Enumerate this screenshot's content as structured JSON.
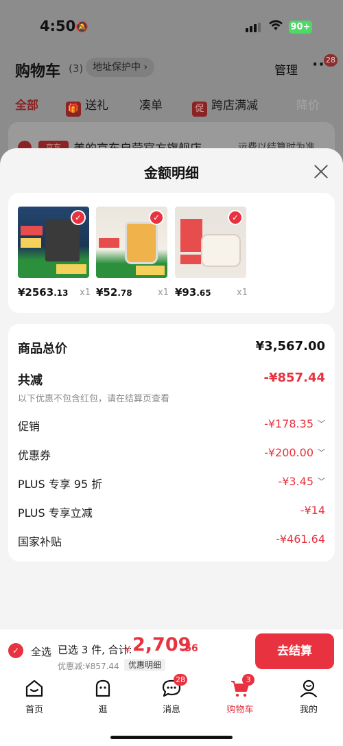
{
  "status_bar": {
    "time": "4:50",
    "battery": "90+"
  },
  "cart_header": {
    "title": "购物车",
    "count": "(3)",
    "address": "地址保护中 ›",
    "manage": "管理",
    "more_badge": "28"
  },
  "cart_tabs": [
    {
      "label": "全部"
    },
    {
      "label": "送礼"
    },
    {
      "label": "凑单"
    },
    {
      "label": "跨店满减",
      "icon": "促"
    },
    {
      "label": "降价"
    }
  ],
  "shop_row": {
    "tag": "京东",
    "name": "美的京东自营官方旗舰店",
    "shipping": "运费以结算时为准"
  },
  "sheet": {
    "title": "金额明细",
    "products": [
      {
        "price_int": "¥2563",
        "price_dec": ".13",
        "qty": "x1",
        "image": "water-heater"
      },
      {
        "price_int": "¥52",
        "price_dec": ".78",
        "qty": "x1",
        "image": "food-processor"
      },
      {
        "price_int": "¥93",
        "price_dec": ".65",
        "qty": "x1",
        "image": "stew-pot"
      }
    ],
    "breakdown": {
      "total_label": "商品总价",
      "total_value": "¥3,567.00",
      "reduce_label": "共减",
      "reduce_value": "-¥857.44",
      "reduce_note": "以下优惠不包含红包，请在结算页查看",
      "items": [
        {
          "label": "促销",
          "value": "-¥178.35",
          "expandable": true
        },
        {
          "label": "优惠券",
          "value": "-¥200.00",
          "expandable": true
        },
        {
          "label": "PLUS 专享 95 折",
          "value": "-¥3.45",
          "expandable": true
        },
        {
          "label": "PLUS 专享立减",
          "value": "-¥14",
          "expandable": false
        },
        {
          "label": "国家补贴",
          "value": "-¥461.64",
          "expandable": false
        }
      ]
    }
  },
  "checkout": {
    "select_all": "全选",
    "selected": "已选 3 件, 合计:",
    "currency": "¥",
    "amount": "2,709",
    "amount_dec": ".56",
    "discount": "优惠减:¥857.44",
    "detail_button": "优惠明细",
    "pay_button": "去结算"
  },
  "tabbar": [
    {
      "label": "首页",
      "icon": "home-icon"
    },
    {
      "label": "逛",
      "icon": "browse-icon"
    },
    {
      "label": "消息",
      "icon": "message-icon",
      "badge": "28"
    },
    {
      "label": "购物车",
      "icon": "cart-icon",
      "badge": "3",
      "active": true
    },
    {
      "label": "我的",
      "icon": "profile-icon"
    }
  ],
  "colors": {
    "accent": "#e8323f",
    "overlay": "#8c8c8c"
  }
}
